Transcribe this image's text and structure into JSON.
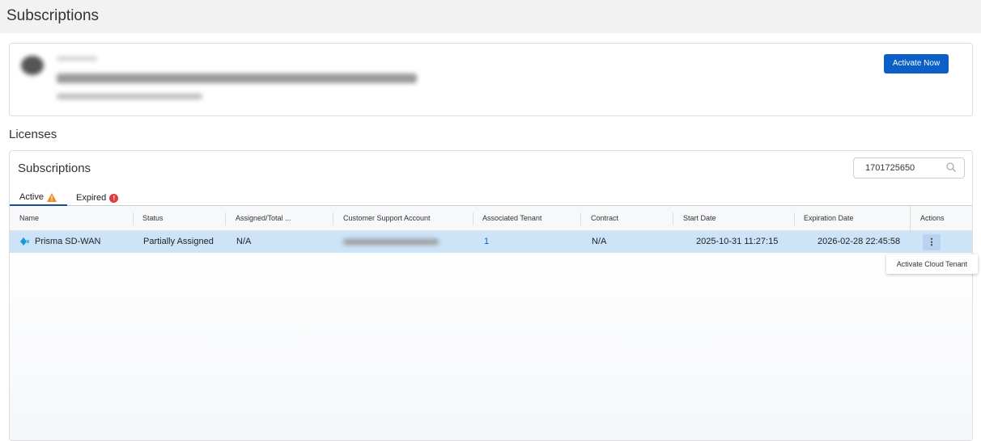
{
  "header": {
    "title": "Subscriptions"
  },
  "banner": {
    "activate_label": "Activate Now"
  },
  "licenses": {
    "heading": "Licenses"
  },
  "subscriptions": {
    "title": "Subscriptions",
    "search_value": "1701725650",
    "tabs": [
      {
        "label": "Active",
        "icon": "warning-icon"
      },
      {
        "label": "Expired",
        "icon": "error-icon",
        "badge": "!"
      }
    ],
    "columns": [
      "Name",
      "Status",
      "Assigned/Total ...",
      "Customer Support Account",
      "Associated Tenant",
      "Contract",
      "Start Date",
      "Expiration Date",
      "Actions"
    ],
    "rows": [
      {
        "name": "Prisma SD-WAN",
        "status": "Partially Assigned",
        "assigned": "N/A",
        "tenant": "1",
        "contract": "N/A",
        "start": "2025-10-31 11:27:15",
        "expiration": "2026-02-28 22:45:58",
        "actions": "⋮"
      }
    ]
  },
  "tooltip": {
    "text": "Activate Cloud Tenant"
  },
  "colors": {
    "primary": "#0b5fc6",
    "selected_row": "#cde3f8",
    "warning": "#f08a24",
    "error": "#e03c3c"
  }
}
